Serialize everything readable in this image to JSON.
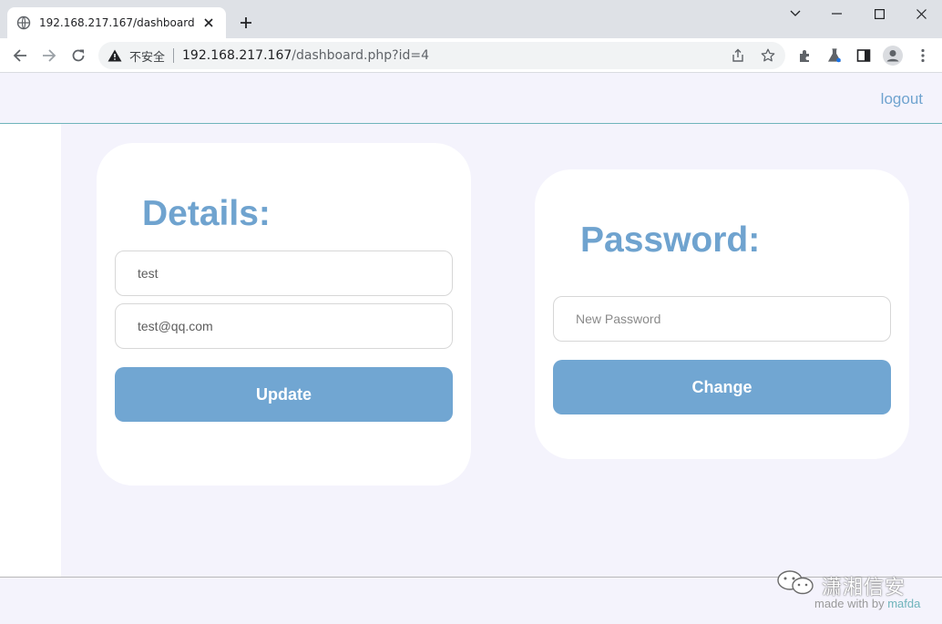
{
  "browser": {
    "tab_title": "192.168.217.167/dashboard.php?id=4",
    "security_label": "不安全",
    "url_host": "192.168.217.167",
    "url_path": "/dashboard.php?id=4"
  },
  "header": {
    "logout_label": "logout"
  },
  "details_card": {
    "title": "Details:",
    "username_value": "test",
    "email_value": "test@qq.com",
    "update_label": "Update"
  },
  "password_card": {
    "title": "Password:",
    "new_password_placeholder": "New Password",
    "change_label": "Change"
  },
  "footer": {
    "watermark_text": "潇湘信安",
    "made_with_prefix": "made with by ",
    "made_with_author": "mafda"
  },
  "colors": {
    "accent": "#71a6d2",
    "title_blue": "#6fa3cf",
    "page_bg": "#f4f3fc",
    "header_border": "#6fb4bb"
  },
  "icons": [
    "globe-icon",
    "tab-close-icon",
    "new-tab-icon",
    "minimize-icon",
    "chevron-down-icon",
    "maximize-icon",
    "window-close-icon",
    "back-icon",
    "forward-icon",
    "reload-icon",
    "warning-icon",
    "share-icon",
    "star-icon",
    "extensions-icon",
    "labs-icon",
    "side-panel-icon",
    "profile-icon",
    "menu-icon",
    "wechat-icon"
  ]
}
